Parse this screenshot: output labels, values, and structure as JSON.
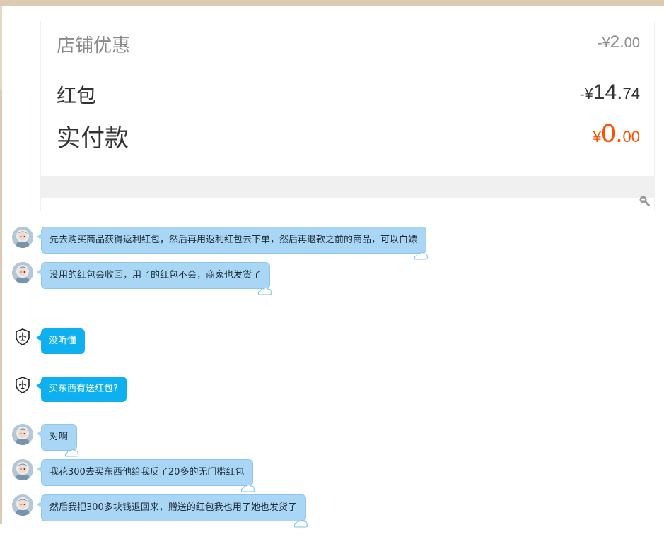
{
  "receipt": {
    "store_discount": {
      "label": "店铺优惠",
      "prefix": "-",
      "currency": "¥",
      "integer": "2.",
      "decimals": "00"
    },
    "red_packet": {
      "label": "红包",
      "prefix": "-",
      "currency": "¥",
      "integer": "14.",
      "decimals": "74"
    },
    "actual_payment": {
      "label": "实付款",
      "currency": "¥",
      "integer": "0.",
      "decimals": "00",
      "color": "#ff5000"
    }
  },
  "zoom_icon": "zoom-in-icon",
  "chat": {
    "user_bubble_color": "#a8d6f4",
    "bot_bubble_color": "#0eb0f0",
    "messages": [
      {
        "sender": "user",
        "text": "先去购买商品获得返利红包，然后再用返利红包去下单，然后再退款之前的商品，可以白嫖"
      },
      {
        "sender": "user",
        "text": "没用的红包会收回，用了的红包不会，商家也发货了"
      },
      {
        "sender": "bot",
        "text": "没听懂"
      },
      {
        "sender": "bot",
        "text": "买东西有送红包?"
      },
      {
        "sender": "user",
        "text": "对啊"
      },
      {
        "sender": "user",
        "text": "我花300去买东西他给我反了20多的无门槛红包"
      },
      {
        "sender": "user",
        "text": "然后我把300多块钱退回来，赠送的红包我也用了她也发货了"
      }
    ]
  }
}
